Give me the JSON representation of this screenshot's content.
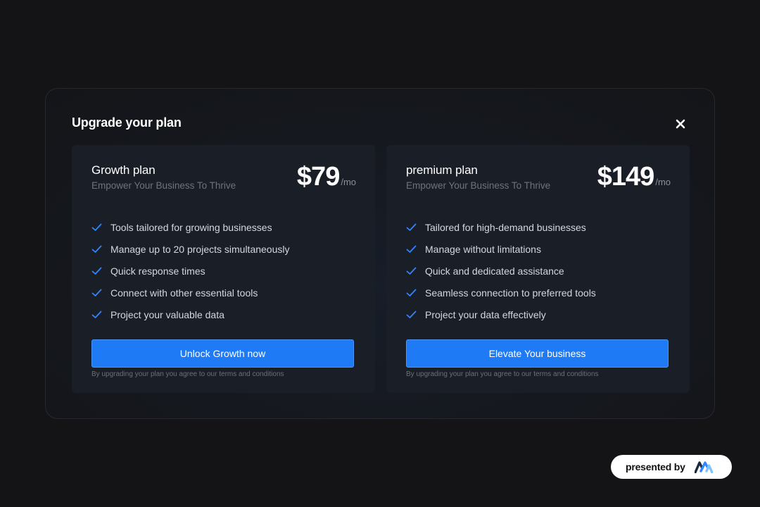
{
  "modal": {
    "title": "Upgrade your plan",
    "close_icon": "close-icon"
  },
  "plans": [
    {
      "name": "Growth plan",
      "tagline": "Empower Your Business To Thrive",
      "price": "$79",
      "period": "/mo",
      "features": [
        "Tools tailored for growing businesses",
        "Manage up to 20 projects simultaneously",
        "Quick response times",
        "Connect with other essential tools",
        "Project your valuable data"
      ],
      "cta": "Unlock Growth now",
      "terms": "By upgrading your plan you agree to our terms and conditions"
    },
    {
      "name": "premium plan",
      "tagline": "Empower Your Business To Thrive",
      "price": "$149",
      "period": "/mo",
      "features": [
        "Tailored for high-demand businesses",
        "Manage without limitations",
        "Quick and dedicated assistance",
        "Seamless connection to preferred tools",
        "Project your  data effectively"
      ],
      "cta": "Elevate Your business",
      "terms": "By upgrading your plan you agree to our terms and conditions"
    }
  ],
  "footer": {
    "presented_by": "presented by",
    "logo_icon": "brand-logo-icon"
  },
  "colors": {
    "accent": "#1e7bf5",
    "check": "#2f86ff",
    "background": "#141416",
    "card": "#1a1e27"
  }
}
